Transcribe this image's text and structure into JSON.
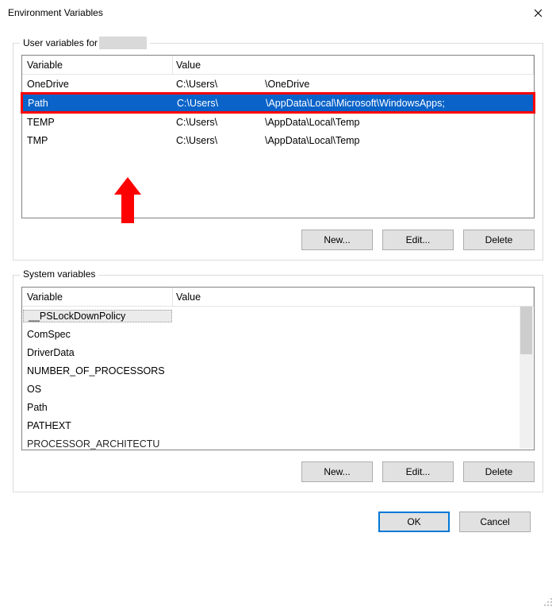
{
  "window": {
    "title": "Environment Variables"
  },
  "user_section": {
    "label_prefix": "User variables for ",
    "columns": {
      "var": "Variable",
      "val": "Value"
    },
    "rows": [
      {
        "var": "OneDrive",
        "val1": "C:\\Users\\",
        "val2": "\\OneDrive",
        "selected": false
      },
      {
        "var": "Path",
        "val1": "C:\\Users\\",
        "val2": "\\AppData\\Local\\Microsoft\\WindowsApps;",
        "selected": true
      },
      {
        "var": "TEMP",
        "val1": "C:\\Users\\",
        "val2": "\\AppData\\Local\\Temp",
        "selected": false
      },
      {
        "var": "TMP",
        "val1": "C:\\Users\\",
        "val2": "\\AppData\\Local\\Temp",
        "selected": false
      }
    ],
    "buttons": {
      "new": "New...",
      "edit": "Edit...",
      "delete": "Delete"
    }
  },
  "system_section": {
    "label": "System variables",
    "columns": {
      "var": "Variable",
      "val": "Value"
    },
    "rows": [
      {
        "var": "__PSLockDownPolicy",
        "val": ""
      },
      {
        "var": "ComSpec",
        "val": ""
      },
      {
        "var": "DriverData",
        "val": ""
      },
      {
        "var": "NUMBER_OF_PROCESSORS",
        "val": ""
      },
      {
        "var": "OS",
        "val": ""
      },
      {
        "var": "Path",
        "val": ""
      },
      {
        "var": "PATHEXT",
        "val": ""
      },
      {
        "var": "PROCESSOR_ARCHITECTU",
        "val": ""
      }
    ],
    "buttons": {
      "new": "New...",
      "edit": "Edit...",
      "delete": "Delete"
    }
  },
  "dialog_buttons": {
    "ok": "OK",
    "cancel": "Cancel"
  },
  "annotation": {
    "arrow_color": "#ff0000"
  }
}
